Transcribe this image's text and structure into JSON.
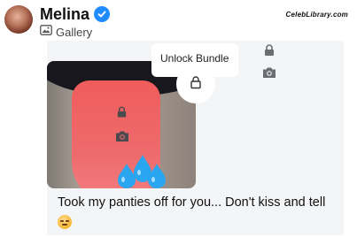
{
  "header": {
    "name": "Melina",
    "subtitle": "Gallery",
    "watermark": "CelebLibrary.com"
  },
  "post": {
    "unlock_label": "Unlock Bundle",
    "caption": "Took my panties off for you... Don't kiss and tell"
  },
  "icons": {
    "verified": "verified-badge-icon",
    "gallery": "gallery-icon",
    "lock": "lock-icon",
    "photo": "camera-icon",
    "emoji": "smirk-emoji-icon",
    "drops": "sweat-droplets-icon"
  },
  "colors": {
    "verified": "#1f8cff",
    "icon_gray": "#6b6e73",
    "panel_bg": "#f4f5f7"
  }
}
